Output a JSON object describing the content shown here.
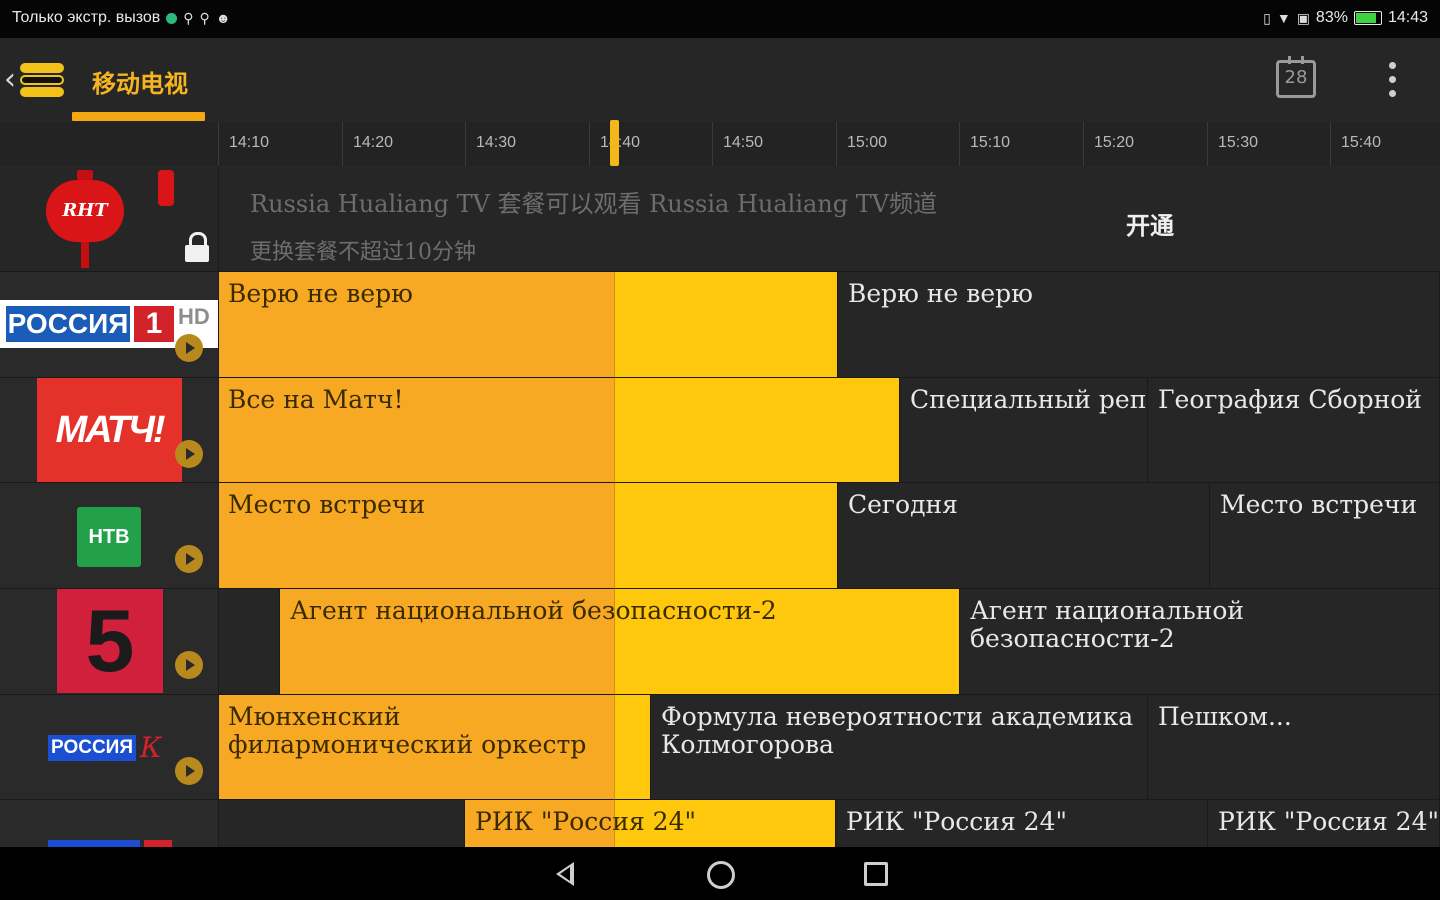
{
  "status_bar": {
    "left_text": "Только экстр. вызов",
    "battery": "83%",
    "time": "14:43"
  },
  "app_bar": {
    "title": "移动电视",
    "calendar_day": "28",
    "accent_color": "#f3a712"
  },
  "timeline": {
    "ticks": [
      "14:10",
      "14:20",
      "14:30",
      "14:40",
      "14:50",
      "15:00",
      "15:10",
      "15:20",
      "15:30",
      "15:40"
    ],
    "now": "14:43"
  },
  "locked_channel": {
    "logo_text": "RHT",
    "line1": "Russia Hualiang TV 套餐可以观看 Russia Hualiang TV频道",
    "line2": "更换套餐不超过10分钟",
    "subscribe_label": "开通"
  },
  "channels": [
    {
      "logo": {
        "word": "РОССИЯ",
        "number": "1",
        "badge": "HD"
      },
      "programs": [
        {
          "title": "Верю не верю",
          "state": "on-air"
        },
        {
          "title": "Верю не верю",
          "state": "future"
        }
      ]
    },
    {
      "logo": {
        "word": "МАТЧ!"
      },
      "programs": [
        {
          "title": "Все на Матч!",
          "state": "on-air"
        },
        {
          "title": "Специальный репортаж",
          "state": "future"
        },
        {
          "title": "География Сборной",
          "state": "future"
        }
      ]
    },
    {
      "logo": {
        "word": "НТВ"
      },
      "programs": [
        {
          "title": "Место встречи",
          "state": "on-air"
        },
        {
          "title": "Сегодня",
          "state": "future"
        },
        {
          "title": "Место встречи",
          "state": "future"
        }
      ]
    },
    {
      "logo": {
        "word": "5"
      },
      "programs": [
        {
          "title": "",
          "state": "future"
        },
        {
          "title": "Агент национальной безопасности-2",
          "state": "on-air"
        },
        {
          "title": "Агент национальной безопасности-2",
          "state": "future"
        }
      ]
    },
    {
      "logo": {
        "word": "РОССИЯ",
        "letter": "К"
      },
      "programs": [
        {
          "title": "Мюнхенский филармонический оркестр",
          "state": "on-air"
        },
        {
          "title": "Формула невероятности академика Колмогорова",
          "state": "future"
        },
        {
          "title": "Пешком...",
          "state": "future"
        }
      ]
    },
    {
      "logo": {
        "word": ""
      },
      "programs": [
        {
          "title": "",
          "state": "future"
        },
        {
          "title": "РИК \"Россия 24\"",
          "state": "on-air"
        },
        {
          "title": "РИК \"Россия 24\"",
          "state": "future"
        },
        {
          "title": "РИК \"Россия 24\"",
          "state": "future"
        }
      ]
    }
  ],
  "colors": {
    "past": "#f8a923",
    "on_air": "#ffc80c",
    "future": "#262626",
    "background": "#232323"
  }
}
